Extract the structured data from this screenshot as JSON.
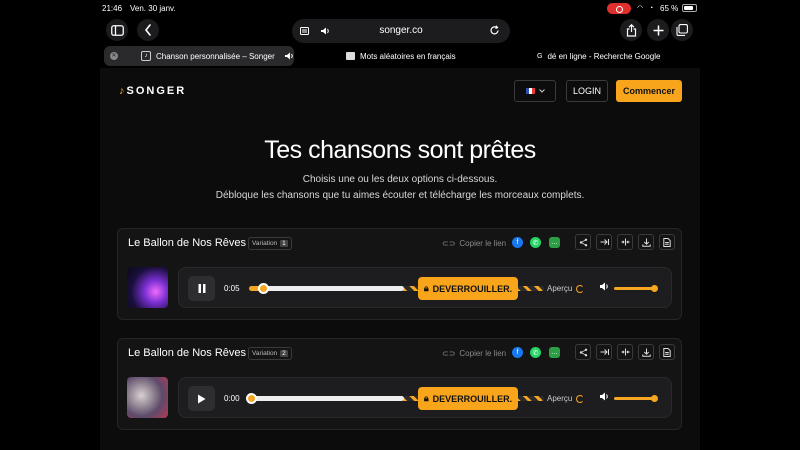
{
  "status": {
    "time": "21:46",
    "date": "Ven. 30 janv.",
    "battery": "65 %"
  },
  "browser": {
    "url": "songer.co",
    "tabs": [
      {
        "title": "Chanson personnalisée – Songer"
      },
      {
        "title": "Mots aléatoires en français"
      },
      {
        "title": "dé en ligne - Recherche Google"
      }
    ]
  },
  "header": {
    "logo": "SONGER",
    "login": "LOGIN",
    "cta": "Commencer"
  },
  "hero": {
    "title": "Tes chansons sont prêtes",
    "line1": "Choisis une ou les deux options ci-dessous.",
    "line2": "Débloque les chansons que tu aimes écouter et télécharge les morceaux complets."
  },
  "songs": [
    {
      "title": "Le Ballon de Nos Rêves",
      "variation_label": "Variation",
      "variation_num": "1",
      "copy_link": "Copier le lien",
      "time": "0:05",
      "unlock": "DEVERROUILLER.",
      "preview": "Aperçu",
      "progress": 0.04,
      "playing": true
    },
    {
      "title": "Le Ballon de Nos Rêves",
      "variation_label": "Variation",
      "variation_num": "2",
      "copy_link": "Copier le lien",
      "time": "0:00",
      "unlock": "DEVERROUILLER.",
      "preview": "Aperçu",
      "progress": 0.0,
      "playing": false
    }
  ],
  "colors": {
    "accent": "#f8a51b",
    "page_bg": "#0c0c0d",
    "card_bg": "#141415"
  }
}
